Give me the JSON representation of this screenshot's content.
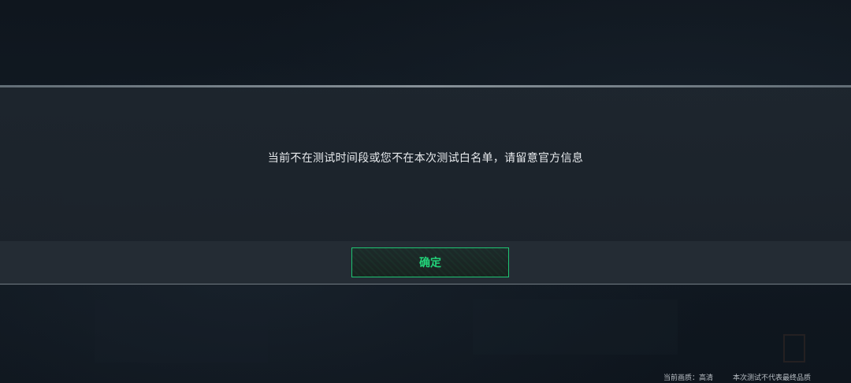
{
  "dialog": {
    "message": "当前不在测试时间段或您不在本次测试白名单，请留意官方信息",
    "confirm_label": "确定"
  },
  "status_bar": {
    "quality_label": "当前画质：高清",
    "note": "本次测试不代表最终品质"
  },
  "colors": {
    "accent": "#22d47a",
    "background": "#0d141c",
    "dialog_background": "#1e262e"
  }
}
